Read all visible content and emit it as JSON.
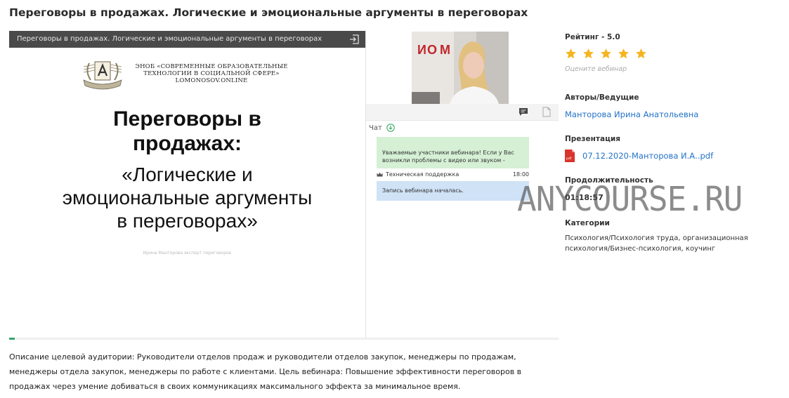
{
  "page": {
    "title": "Переговоры в продажах. Логические и эмоциональные аргументы в переговорах"
  },
  "player": {
    "slide_bar_title": "Переговоры в продажах. Логические и эмоциональные аргументы в переговорах",
    "slide": {
      "logo_line1": "ЭНОБ «СОВРЕМЕННЫЕ ОБРАЗОВАТЕЛЬНЫЕ",
      "logo_line2": "ТЕХНОЛОГИИ В СОЦИАЛЬНОЙ СФЕРЕ»",
      "logo_line3": "LOMONOSOV.ONLINE",
      "heading_line1": "Переговоры в",
      "heading_line2": "продажах:",
      "sub_line1": "«Логические и",
      "sub_line2": "эмоциональные аргументы",
      "sub_line3": "в переговорах»",
      "footer": "Ирина Манторова    эксперт переговоров"
    },
    "chat": {
      "label": "Чат",
      "message1": "Уважаемые участники вебинара! Если у Вас возникли проблемы с видео или звуком -",
      "support_name": "Техническая поддержка",
      "support_time": "18:00",
      "message2": "Запись вебинара началась."
    },
    "progress": 0.01
  },
  "info": {
    "rating_label": "Рейтинг - 5.0",
    "rating_value": 5,
    "rate_hint": "Оцените вебинар",
    "authors_label": "Авторы/Ведущие",
    "author": "Манторова Ирина Анатольевна",
    "presentation_label": "Презентация",
    "presentation_file": "07.12.2020-Манторова И.А..pdf",
    "duration_label": "Продолжительность",
    "duration": "01:18:57",
    "categories_label": "Категории",
    "categories_line1": "Психология/Психология труда, организационная",
    "categories_line2": "психология/Бизнес-психология, коучинг"
  },
  "watermark": "ANYCOURSE.RU",
  "description": {
    "line1": "Описание целевой аудитории: Руководители отделов продаж и руководители отделов закупок, менеджеры по продажам,",
    "line2": "менеджеры отдела закупок, менеджеры по работе с клиентами. Цель вебинара: Повышение эффективности переговоров в",
    "line3": "продажах через умение добиваться в своих коммуникациях максимального эффекта за минимальное время."
  },
  "colors": {
    "accent_link": "#2473c7",
    "star": "#f5b521",
    "chat_green": "#d5f0d5",
    "chat_blue": "#cfe2f6",
    "progress": "#35a56b"
  }
}
